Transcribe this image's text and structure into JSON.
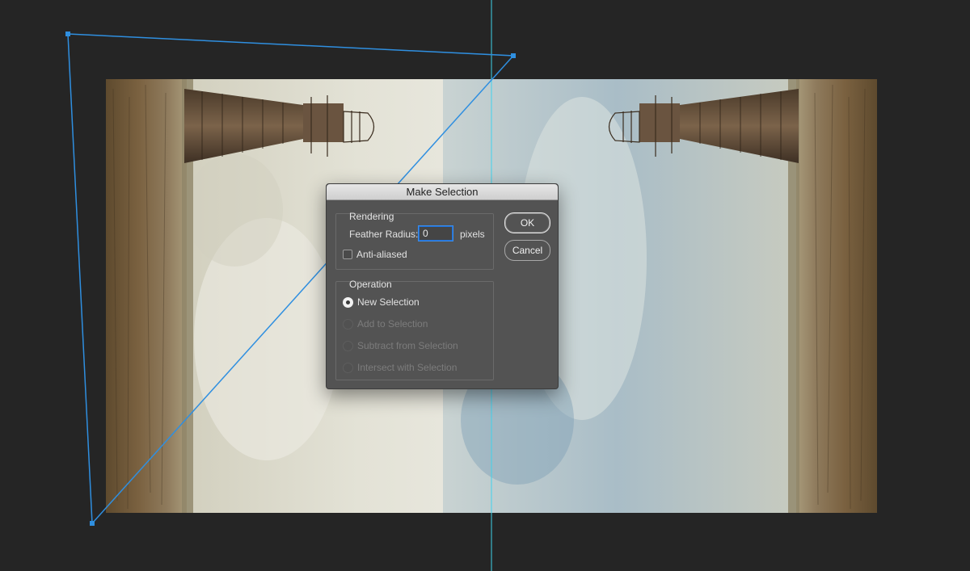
{
  "dialog": {
    "title": "Make Selection",
    "rendering": {
      "group_title": "Rendering",
      "feather_label": "Feather Radius:",
      "feather_value": "0",
      "feather_unit": "pixels",
      "anti_aliased_label": "Anti-aliased",
      "anti_aliased_checked": false
    },
    "operation": {
      "group_title": "Operation",
      "options": [
        {
          "label": "New Selection",
          "selected": true,
          "enabled": true
        },
        {
          "label": "Add to Selection",
          "selected": false,
          "enabled": false
        },
        {
          "label": "Subtract from Selection",
          "selected": false,
          "enabled": false
        },
        {
          "label": "Intersect with Selection",
          "selected": false,
          "enabled": false
        }
      ]
    },
    "ok_label": "OK",
    "cancel_label": "Cancel"
  },
  "colors": {
    "workspace": "#252525",
    "path": "#2f8fe0",
    "guide": "#3fd3ec",
    "dialog_bg": "#535353"
  },
  "canvas_image": "mirrored photo of a rusted lighthouse lying sideways on a rocky shore under a cloudy sky"
}
